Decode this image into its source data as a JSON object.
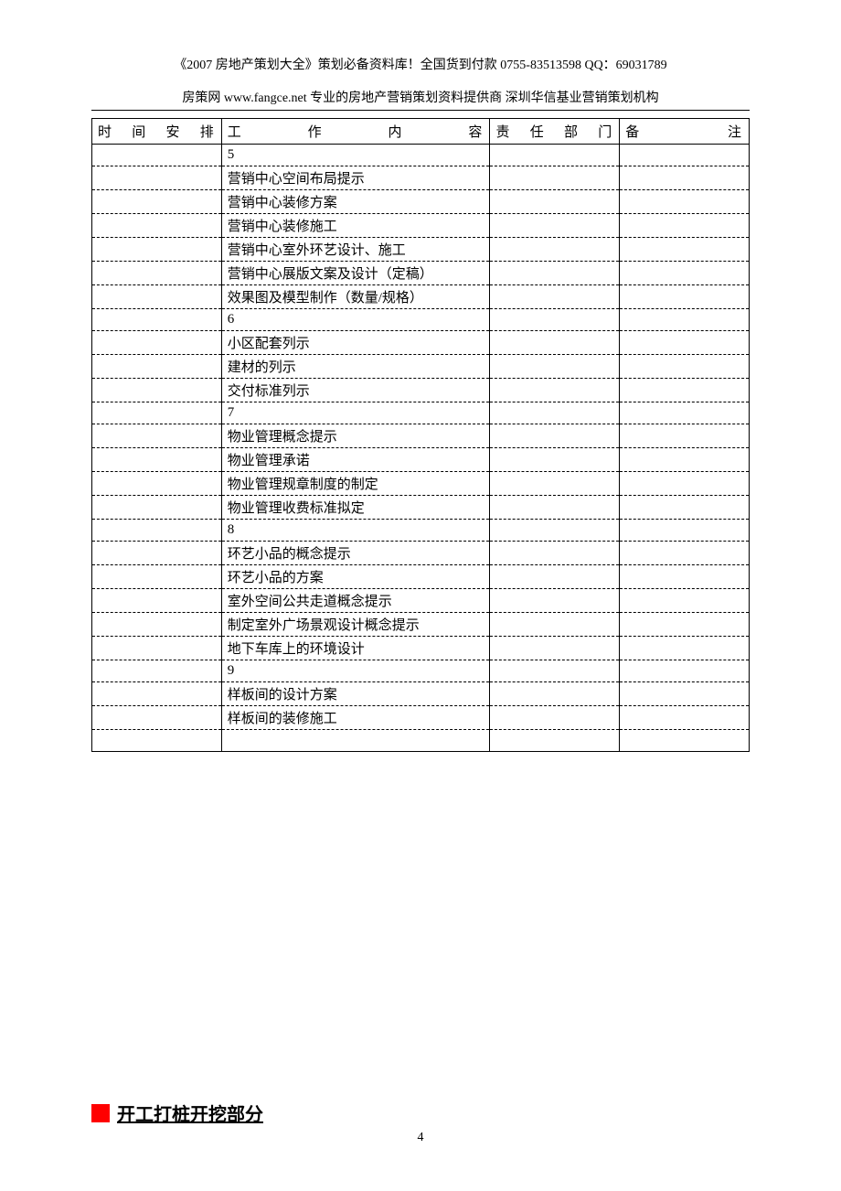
{
  "header": {
    "line1": "《2007 房地产策划大全》策划必备资料库！全国货到付款 0755-83513598   QQ：69031789",
    "line2": "房策网 www.fangce.net  专业的房地产营销策划资料提供商    深圳华信基业营销策划机构"
  },
  "table": {
    "headers": {
      "time": "时间安排",
      "content": "工作内容",
      "dept": "责任部门",
      "note": "备注"
    },
    "rows": [
      {
        "time": "",
        "content": "5",
        "dept": "",
        "note": ""
      },
      {
        "time": "",
        "content": "营销中心空间布局提示",
        "dept": "",
        "note": ""
      },
      {
        "time": "",
        "content": "营销中心装修方案",
        "dept": "",
        "note": ""
      },
      {
        "time": "",
        "content": "营销中心装修施工",
        "dept": "",
        "note": ""
      },
      {
        "time": "",
        "content": "营销中心室外环艺设计、施工",
        "dept": "",
        "note": ""
      },
      {
        "time": "",
        "content": "营销中心展版文案及设计（定稿）",
        "dept": "",
        "note": ""
      },
      {
        "time": "",
        "content": "效果图及模型制作（数量/规格）",
        "dept": "",
        "note": ""
      },
      {
        "time": "",
        "content": "6",
        "dept": "",
        "note": ""
      },
      {
        "time": "",
        "content": "小区配套列示",
        "dept": "",
        "note": ""
      },
      {
        "time": "",
        "content": "建材的列示",
        "dept": "",
        "note": ""
      },
      {
        "time": "",
        "content": "交付标准列示",
        "dept": "",
        "note": ""
      },
      {
        "time": "",
        "content": "7",
        "dept": "",
        "note": ""
      },
      {
        "time": "",
        "content": "物业管理概念提示",
        "dept": "",
        "note": ""
      },
      {
        "time": "",
        "content": "物业管理承诺",
        "dept": "",
        "note": ""
      },
      {
        "time": "",
        "content": "物业管理规章制度的制定",
        "dept": "",
        "note": ""
      },
      {
        "time": "",
        "content": "物业管理收费标准拟定",
        "dept": "",
        "note": ""
      },
      {
        "time": "",
        "content": "8",
        "dept": "",
        "note": ""
      },
      {
        "time": "",
        "content": "环艺小品的概念提示",
        "dept": "",
        "note": ""
      },
      {
        "time": "",
        "content": "环艺小品的方案",
        "dept": "",
        "note": ""
      },
      {
        "time": "",
        "content": "室外空间公共走道概念提示",
        "dept": "",
        "note": ""
      },
      {
        "time": "",
        "content": "制定室外广场景观设计概念提示",
        "dept": "",
        "note": ""
      },
      {
        "time": "",
        "content": "地下车库上的环境设计",
        "dept": "",
        "note": ""
      },
      {
        "time": "",
        "content": "9",
        "dept": "",
        "note": ""
      },
      {
        "time": "",
        "content": "样板间的设计方案",
        "dept": "",
        "note": ""
      },
      {
        "time": "",
        "content": "样板间的装修施工",
        "dept": "",
        "note": ""
      },
      {
        "time": "",
        "content": "",
        "dept": "",
        "note": ""
      }
    ]
  },
  "section": {
    "title": "开工打桩开挖部分"
  },
  "pageNumber": "4"
}
